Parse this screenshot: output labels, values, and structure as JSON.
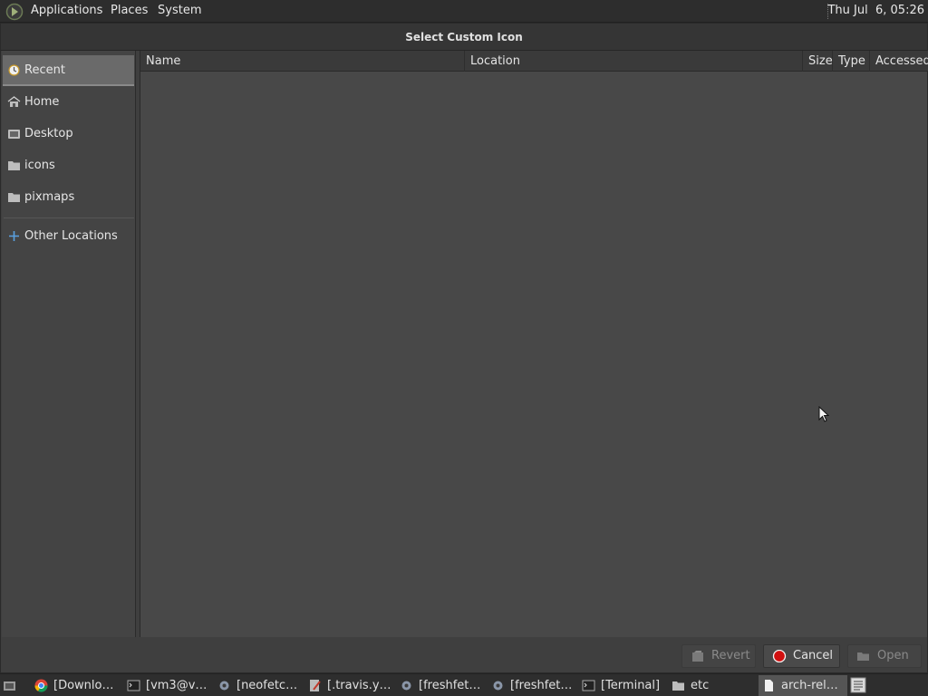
{
  "top_panel": {
    "menus": [
      "Applications",
      "Places",
      "System"
    ],
    "clock": "Thu Jul  6, 05:26"
  },
  "dialog": {
    "title": "Select Custom Icon",
    "places": [
      {
        "label": "Recent",
        "icon": "recent-icon",
        "selected": true
      },
      {
        "label": "Home",
        "icon": "home-icon"
      },
      {
        "label": "Desktop",
        "icon": "desktop-icon"
      },
      {
        "label": "icons",
        "icon": "folder-icon"
      },
      {
        "label": "pixmaps",
        "icon": "folder-icon"
      },
      {
        "label": "Other Locations",
        "icon": "plus-icon"
      }
    ],
    "columns": [
      "Name",
      "Location",
      "Size",
      "Type",
      "Accessed"
    ],
    "buttons": {
      "revert": "Revert",
      "cancel": "Cancel",
      "open": "Open"
    }
  },
  "taskbar": {
    "tasks": [
      {
        "label": "[Downlo…",
        "icon": "chrome-icon"
      },
      {
        "label": "[vm3@v…",
        "icon": "terminal-icon"
      },
      {
        "label": "[neofetc…",
        "icon": "gear-icon"
      },
      {
        "label": "[.travis.y…",
        "icon": "text-editor-icon"
      },
      {
        "label": "[freshfet…",
        "icon": "gear-icon"
      },
      {
        "label": "[freshfet…",
        "icon": "gear-icon"
      },
      {
        "label": "[Terminal]",
        "icon": "terminal-icon"
      },
      {
        "label": "etc",
        "icon": "folder-icon"
      },
      {
        "label": "arch-rel…",
        "icon": "document-icon",
        "active": true
      }
    ]
  },
  "colors": {
    "cancel_red": "#d01010",
    "panel_bg": "#2d2d2d",
    "dialog_bg": "#3f3f3f"
  }
}
